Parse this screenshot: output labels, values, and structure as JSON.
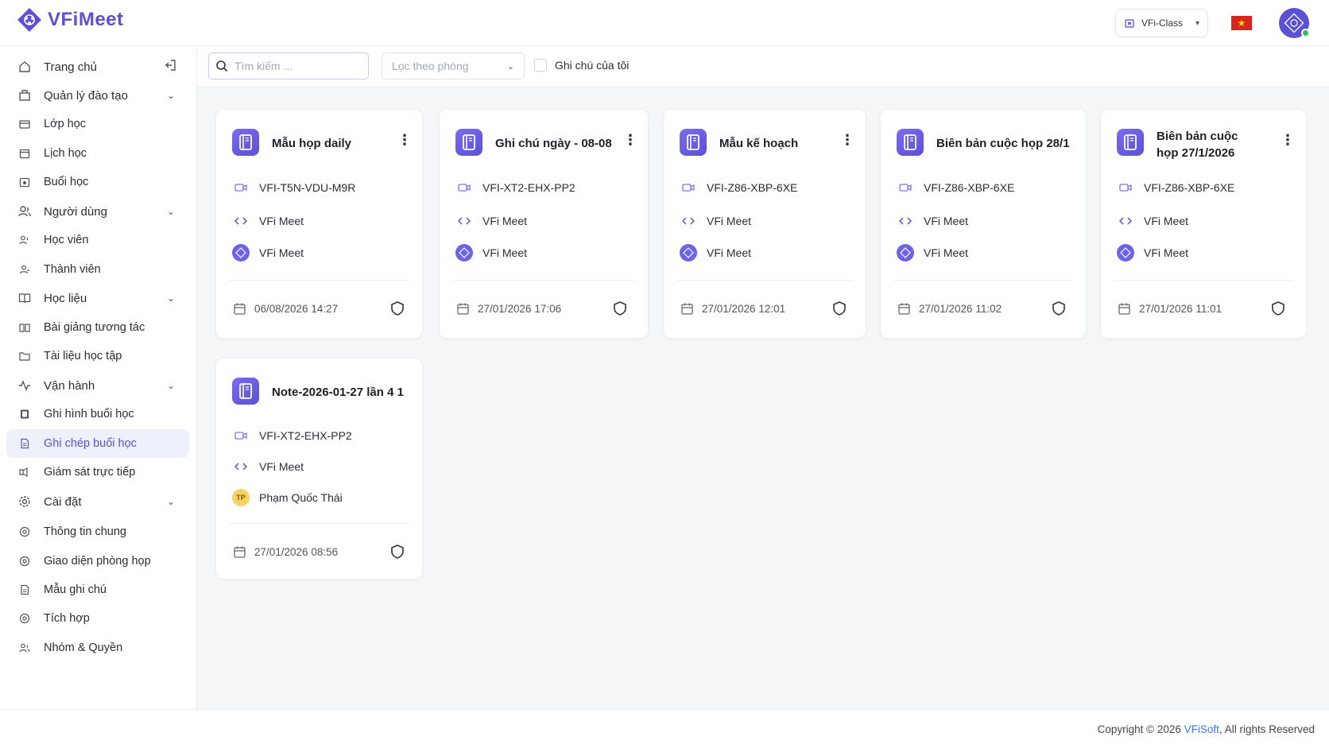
{
  "app": {
    "logo_prefix": "VFi",
    "logo_suffix": "Meet"
  },
  "header": {
    "org_label": "VFi-Class",
    "language": "vietnam-flag"
  },
  "sidebar": {
    "items": [
      {
        "label": "Trang chủ",
        "icon": "home-icon"
      },
      {
        "label": "Quản lý đào tạo",
        "icon": "building-icon"
      },
      {
        "label": "Lớp học",
        "icon": "class-icon"
      },
      {
        "label": "Lịch học",
        "icon": "calendar-icon"
      },
      {
        "label": "Buổi học",
        "icon": "session-icon"
      },
      {
        "label": "Người dùng",
        "icon": "users-icon"
      },
      {
        "label": "Học viên",
        "icon": "student-icon"
      },
      {
        "label": "Thành viên",
        "icon": "member-icon"
      },
      {
        "label": "Học liệu",
        "icon": "book-icon"
      },
      {
        "label": "Bài giảng tương tác",
        "icon": "lecture-icon"
      },
      {
        "label": "Tài liệu học tập",
        "icon": "folder-icon"
      },
      {
        "label": "Vận hành",
        "icon": "activity-icon"
      },
      {
        "label": "Ghi hình buổi học",
        "icon": "film-icon"
      },
      {
        "label": "Ghi chép buổi học",
        "icon": "note-icon"
      },
      {
        "label": "Giám sát trực tiếp",
        "icon": "monitor-icon"
      },
      {
        "label": "Cài đặt",
        "icon": "settings-icon"
      },
      {
        "label": "Thông tin chung",
        "icon": "info-icon"
      },
      {
        "label": "Giao diện phòng họp",
        "icon": "layout-icon"
      },
      {
        "label": "Mẫu ghi chú",
        "icon": "template-icon"
      },
      {
        "label": "Tích hợp",
        "icon": "integration-icon"
      },
      {
        "label": "Nhóm & Quyền",
        "icon": "group-icon"
      }
    ]
  },
  "toolbar": {
    "search_placeholder": "Tìm kiếm ...",
    "room_filter_placeholder": "Lọc theo phòng",
    "my_notes_label": "Ghi chú của tôi"
  },
  "notes": [
    {
      "title": "Mẫu họp daily",
      "room": "VFI-T5N-VDU-M9R",
      "source": "VFi Meet",
      "owner": "VFi Meet",
      "owner_type": "logo",
      "date": "06/08/2026 14:27"
    },
    {
      "title": "Ghi chú ngày - 08-08",
      "room": "VFI-XT2-EHX-PP2",
      "source": "VFi Meet",
      "owner": "VFi Meet",
      "owner_type": "logo",
      "date": "27/01/2026 17:06"
    },
    {
      "title": "Mẫu kế hoạch",
      "room": "VFI-Z86-XBP-6XE",
      "source": "VFi Meet",
      "owner": "VFi Meet",
      "owner_type": "logo",
      "date": "27/01/2026 12:01"
    },
    {
      "title": "Biên bản cuộc họp 28/1",
      "room": "VFI-Z86-XBP-6XE",
      "source": "VFi Meet",
      "owner": "VFi Meet",
      "owner_type": "logo",
      "date": "27/01/2026 11:02"
    },
    {
      "title_line1": "Biên bản cuộc",
      "title_line2": "họp 27/1/2026",
      "room": "VFI-Z86-XBP-6XE",
      "source": "VFi Meet",
      "owner": "VFi Meet",
      "owner_type": "logo",
      "date": "27/01/2026 11:01"
    },
    {
      "title": "Note-2026-01-27 lần 4 1",
      "room": "VFI-XT2-EHX-PP2",
      "source": "VFi Meet",
      "owner": "Phạm Quốc Thái",
      "owner_initials": "TP",
      "owner_type": "avatar",
      "date": "27/01/2026 08:56"
    }
  ],
  "footer": {
    "copy_prefix": "Copyright © 2026 ",
    "copy_brand": "VFiSoft",
    "copy_suffix": ", All rights Reserved"
  }
}
